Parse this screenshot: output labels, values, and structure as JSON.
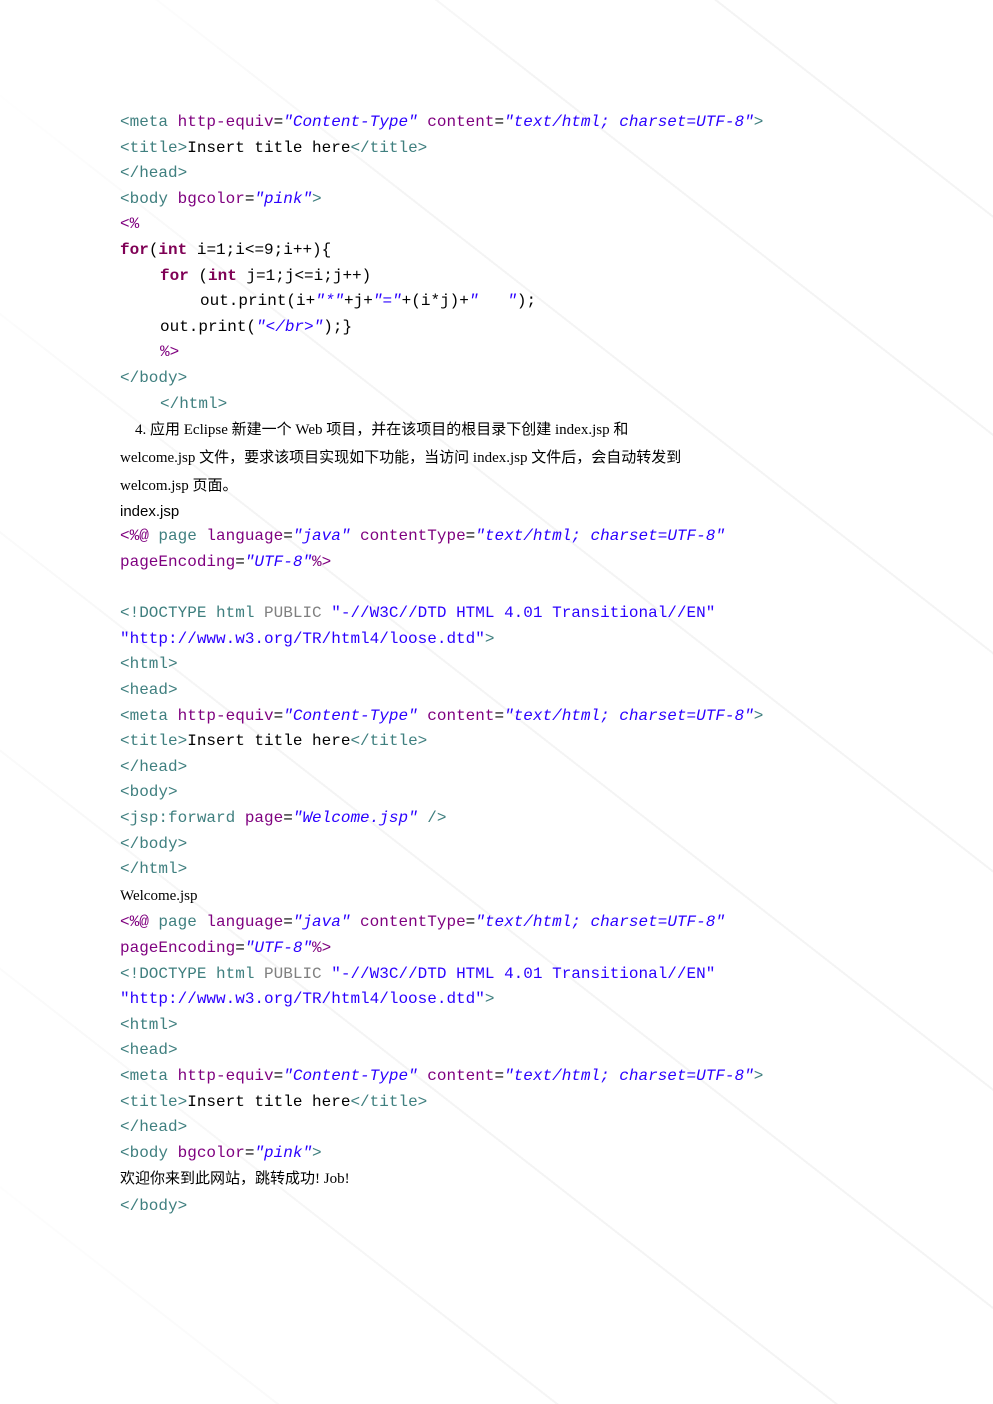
{
  "block1": {
    "l1_a": "<meta ",
    "l1_b": "http-equiv",
    "l1_c": "=",
    "l1_d": "\"Content-Type\"",
    "l1_e": " content",
    "l1_f": "=",
    "l1_g": "\"text/html; charset=UTF-8\"",
    "l1_h": ">",
    "l2_a": "<title>",
    "l2_b": "Insert title here",
    "l2_c": "</title>",
    "l3": "</head>",
    "l4_a": "<body ",
    "l4_b": "bgcolor",
    "l4_c": "=",
    "l4_d": "\"pink\"",
    "l4_e": ">",
    "l5": "<%",
    "l6_a": "for",
    "l6_b": "(",
    "l6_c": "int",
    "l6_d": " i=1;i<=9;i++){",
    "l7_a": "for ",
    "l7_b": "(",
    "l7_c": "int",
    "l7_d": " j=1;j<=i;j++)",
    "l8_a": "out.print(i+",
    "l8_b": "\"*\"",
    "l8_c": "+j+",
    "l8_d": "\"=\"",
    "l8_e": "+(i*j)+",
    "l8_f": "\"   \"",
    "l8_g": ");",
    "l9_a": "out.print(",
    "l9_b": "\"</br>\"",
    "l9_c": ");}",
    "l10": "%>",
    "l11": "</body>",
    "l12": "</html>"
  },
  "prose": {
    "p1_indent": "    4. 应用 Eclipse 新建一个 Web 项目，并在该项目的根目录下创建 index.jsp 和",
    "p2": "welcome.jsp 文件，要求该项目实现如下功能，当访问 index.jsp 文件后，会自动转发到",
    "p3": "welcom.jsp 页面。"
  },
  "file1_label": "index.jsp",
  "block2": {
    "l1_a": "<%@ ",
    "l1_b": "page ",
    "l1_c": "language",
    "l1_d": "=",
    "l1_e": "\"java\"",
    "l1_f": " contentType",
    "l1_g": "=",
    "l1_h": "\"text/html; charset=UTF-8\"",
    "l2_a": "pageEncoding",
    "l2_b": "=",
    "l2_c": "\"UTF-8\"",
    "l2_d": "%>",
    "l4_a": "<!DOCTYPE ",
    "l4_b": "html ",
    "l4_c": "PUBLIC ",
    "l4_d": "\"-//W3C//DTD HTML 4.01 Transitional//EN\"",
    "l5": "\"http://www.w3.org/TR/html4/loose.dtd\"",
    "l5_b": ">",
    "l6": "<html>",
    "l7": "<head>",
    "l8_a": "<meta ",
    "l8_b": "http-equiv",
    "l8_c": "=",
    "l8_d": "\"Content-Type\"",
    "l8_e": " content",
    "l8_f": "=",
    "l8_g": "\"text/html; charset=UTF-8\"",
    "l8_h": ">",
    "l9_a": "<title>",
    "l9_b": "Insert title here",
    "l9_c": "</title>",
    "l10": "</head>",
    "l11": "<body>",
    "l12_a": "<jsp:forward ",
    "l12_b": "page",
    "l12_c": "=",
    "l12_d": "\"Welcome.jsp\"",
    "l12_e": " />",
    "l13": "</body>",
    "l14": "</html>"
  },
  "file2_label": "Welcome.jsp",
  "block3": {
    "l1_a": "<%@ ",
    "l1_b": "page ",
    "l1_c": "language",
    "l1_d": "=",
    "l1_e": "\"java\"",
    "l1_f": " contentType",
    "l1_g": "=",
    "l1_h": "\"text/html; charset=UTF-8\"",
    "l2_a": "pageEncoding",
    "l2_b": "=",
    "l2_c": "\"UTF-8\"",
    "l2_d": "%>",
    "l3_a": "<!DOCTYPE ",
    "l3_b": "html ",
    "l3_c": "PUBLIC ",
    "l3_d": "\"-//W3C//DTD HTML 4.01 Transitional//EN\"",
    "l4": "\"http://www.w3.org/TR/html4/loose.dtd\"",
    "l4_b": ">",
    "l5": "<html>",
    "l6": "<head>",
    "l7_a": "<meta ",
    "l7_b": "http-equiv",
    "l7_c": "=",
    "l7_d": "\"Content-Type\"",
    "l7_e": " content",
    "l7_f": "=",
    "l7_g": "\"text/html; charset=UTF-8\"",
    "l7_h": ">",
    "l8_a": "<title>",
    "l8_b": "Insert title here",
    "l8_c": "</title>",
    "l9": "</head>",
    "l10_a": "<body ",
    "l10_b": "bgcolor",
    "l10_c": "=",
    "l10_d": "\"pink\"",
    "l10_e": ">",
    "l11": "欢迎你来到此网站，跳转成功! Job!",
    "l12": "</body>"
  }
}
